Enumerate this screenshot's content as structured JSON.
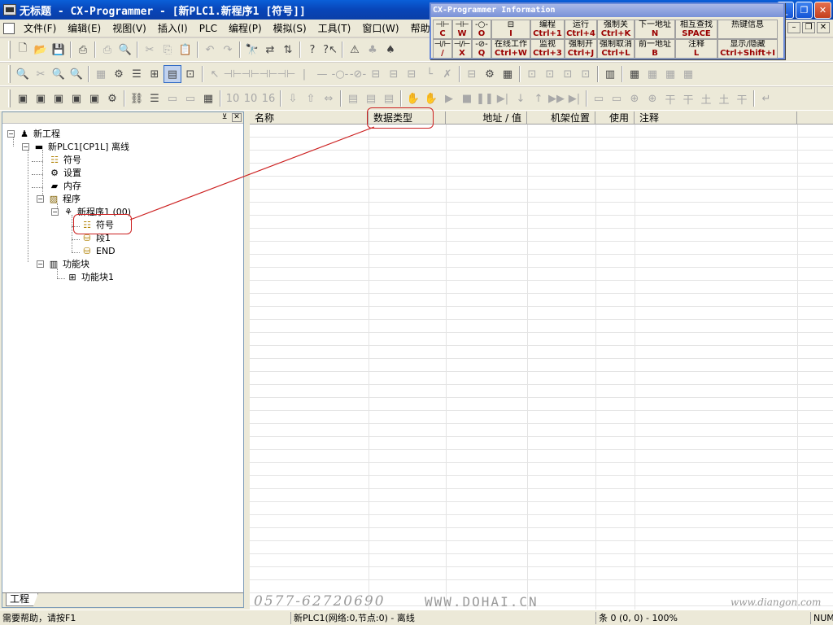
{
  "window": {
    "title": "无标题 - CX-Programmer - [新PLC1.新程序1 [符号]]",
    "minimize": "_",
    "restore": "❐",
    "close": "✕"
  },
  "menu": [
    "文件(F)",
    "编辑(E)",
    "视图(V)",
    "插入(I)",
    "PLC",
    "编程(P)",
    "模拟(S)",
    "工具(T)",
    "窗口(W)",
    "帮助(H)"
  ],
  "info_window": {
    "title": "CX-Programmer Information",
    "rows": [
      [
        {
          "top": "⊣⊢",
          "key": "C"
        },
        {
          "top": "⊣⊢",
          "key": "W"
        },
        {
          "top": "-○-",
          "key": "O"
        },
        {
          "top": "⊟",
          "key": "I"
        },
        {
          "top": "编程",
          "key": "Ctrl+1"
        },
        {
          "top": "运行",
          "key": "Ctrl+4"
        },
        {
          "top": "强制关",
          "key": "Ctrl+K"
        },
        {
          "top": "下一地址",
          "key": "N"
        },
        {
          "top": "相互查找",
          "key": "SPACE"
        },
        {
          "top": "热键信息",
          "key": ""
        }
      ],
      [
        {
          "top": "⊣/⊢",
          "key": "/"
        },
        {
          "top": "⊣/⊢",
          "key": "X"
        },
        {
          "top": "-⊘-",
          "key": "Q"
        },
        {
          "top": "在线工作",
          "key": "Ctrl+W"
        },
        {
          "top": "监视",
          "key": "Ctrl+3"
        },
        {
          "top": "强制开",
          "key": "Ctrl+J"
        },
        {
          "top": "强制取消",
          "key": "Ctrl+L"
        },
        {
          "top": "前一地址",
          "key": "B"
        },
        {
          "top": "注释",
          "key": "L"
        },
        {
          "top": "显示/隐藏",
          "key": "Ctrl+Shift+I"
        }
      ]
    ]
  },
  "project_tree": {
    "tab_label": "工程",
    "items": [
      {
        "label": "新工程",
        "icon": "project-icon"
      },
      {
        "label": "新PLC1[CP1L] 离线",
        "icon": "plc-icon"
      },
      {
        "label": "符号",
        "icon": "symbols-icon"
      },
      {
        "label": "设置",
        "icon": "settings-icon"
      },
      {
        "label": "内存",
        "icon": "memory-icon"
      },
      {
        "label": "程序",
        "icon": "programs-icon"
      },
      {
        "label": "新程序1 (00)",
        "icon": "program-icon"
      },
      {
        "label": "符号",
        "icon": "symbols-icon"
      },
      {
        "label": "段1",
        "icon": "section-icon"
      },
      {
        "label": "END",
        "icon": "end-section-icon"
      },
      {
        "label": "功能块",
        "icon": "function-blocks-icon"
      },
      {
        "label": "功能块1",
        "icon": "function-block-icon"
      }
    ]
  },
  "symbol_table": {
    "columns": [
      "名称",
      "数据类型",
      "地址 / 值",
      "机架位置",
      "使用",
      "注释"
    ]
  },
  "watermarks": {
    "phone": "0577-62720690",
    "site1": "WWW.DOHAI.CN",
    "site2": "www.diangon.com"
  },
  "status_bar": {
    "help": "需要帮助，请按F1",
    "plc": "新PLC1(网络:0,节点:0) - 离线",
    "rung": "条 0 (0, 0)  - 100%",
    "num": "NUM"
  },
  "colors": {
    "annotation": "#cc2020",
    "title_bar": "#0a5fd8",
    "hotkey": "#9a0000"
  }
}
